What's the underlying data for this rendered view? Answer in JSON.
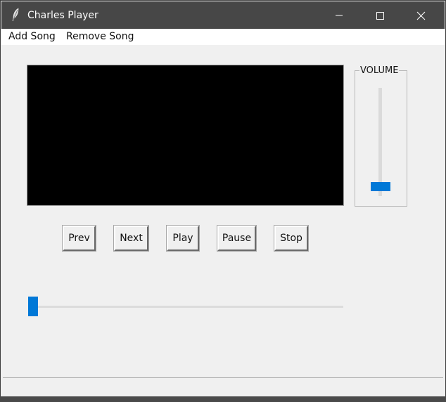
{
  "window": {
    "title": "Charles Player",
    "icon": "feather-icon",
    "controls": [
      "minimize-icon",
      "maximize-icon",
      "close-icon"
    ]
  },
  "menu": {
    "add_song": "Add Song",
    "remove_song": "Remove Song"
  },
  "volume": {
    "label": "VOLUME",
    "level": 0.05
  },
  "controls": {
    "prev": "Prev",
    "next": "Next",
    "play": "Play",
    "pause": "Pause",
    "stop": "Stop"
  },
  "progress": {
    "position": 0
  },
  "colors": {
    "titlebar": "#474747",
    "accent": "#0078d7",
    "screen": "#000000"
  }
}
